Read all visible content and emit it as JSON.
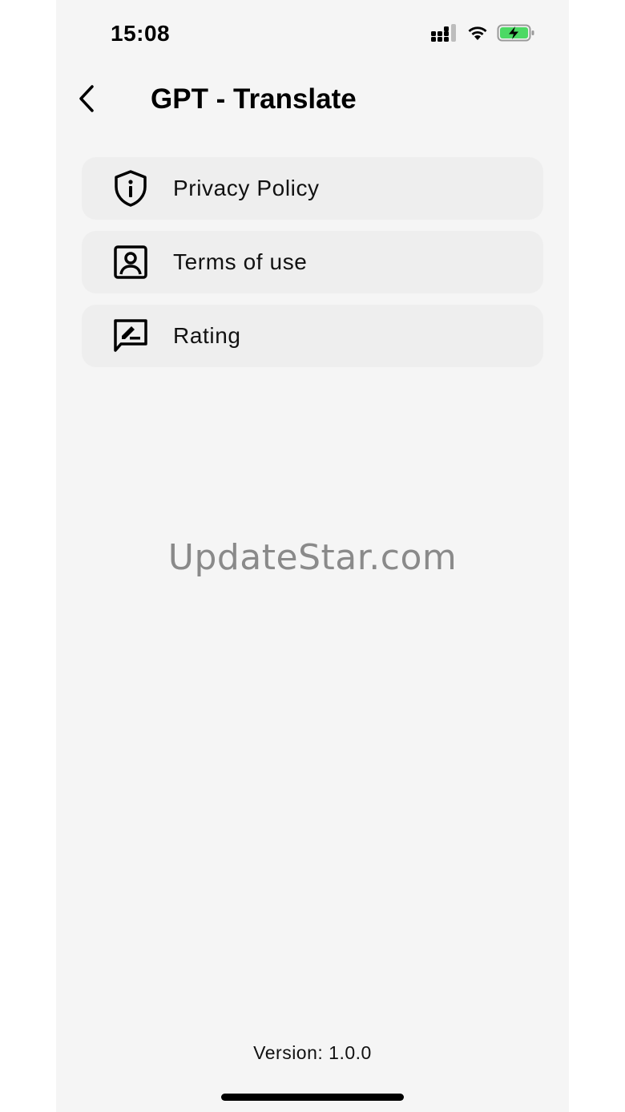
{
  "status_bar": {
    "time": "15:08",
    "icons": [
      "cellular-signal-icon",
      "wifi-icon",
      "battery-charging-icon"
    ],
    "battery_color": "#4cd964"
  },
  "nav": {
    "back_icon": "chevron-left-icon",
    "title": "GPT - Translate"
  },
  "menu": {
    "items": [
      {
        "label": "Privacy Policy",
        "icon": "shield-info-icon"
      },
      {
        "label": "Terms of use",
        "icon": "portrait-user-icon"
      },
      {
        "label": "Rating",
        "icon": "rate-review-icon"
      }
    ]
  },
  "watermark": "UpdateStar.com",
  "footer": {
    "version": "Version: 1.0.0"
  },
  "colors": {
    "background": "#f5f5f5",
    "card": "#eeeeee",
    "text": "#111111"
  }
}
